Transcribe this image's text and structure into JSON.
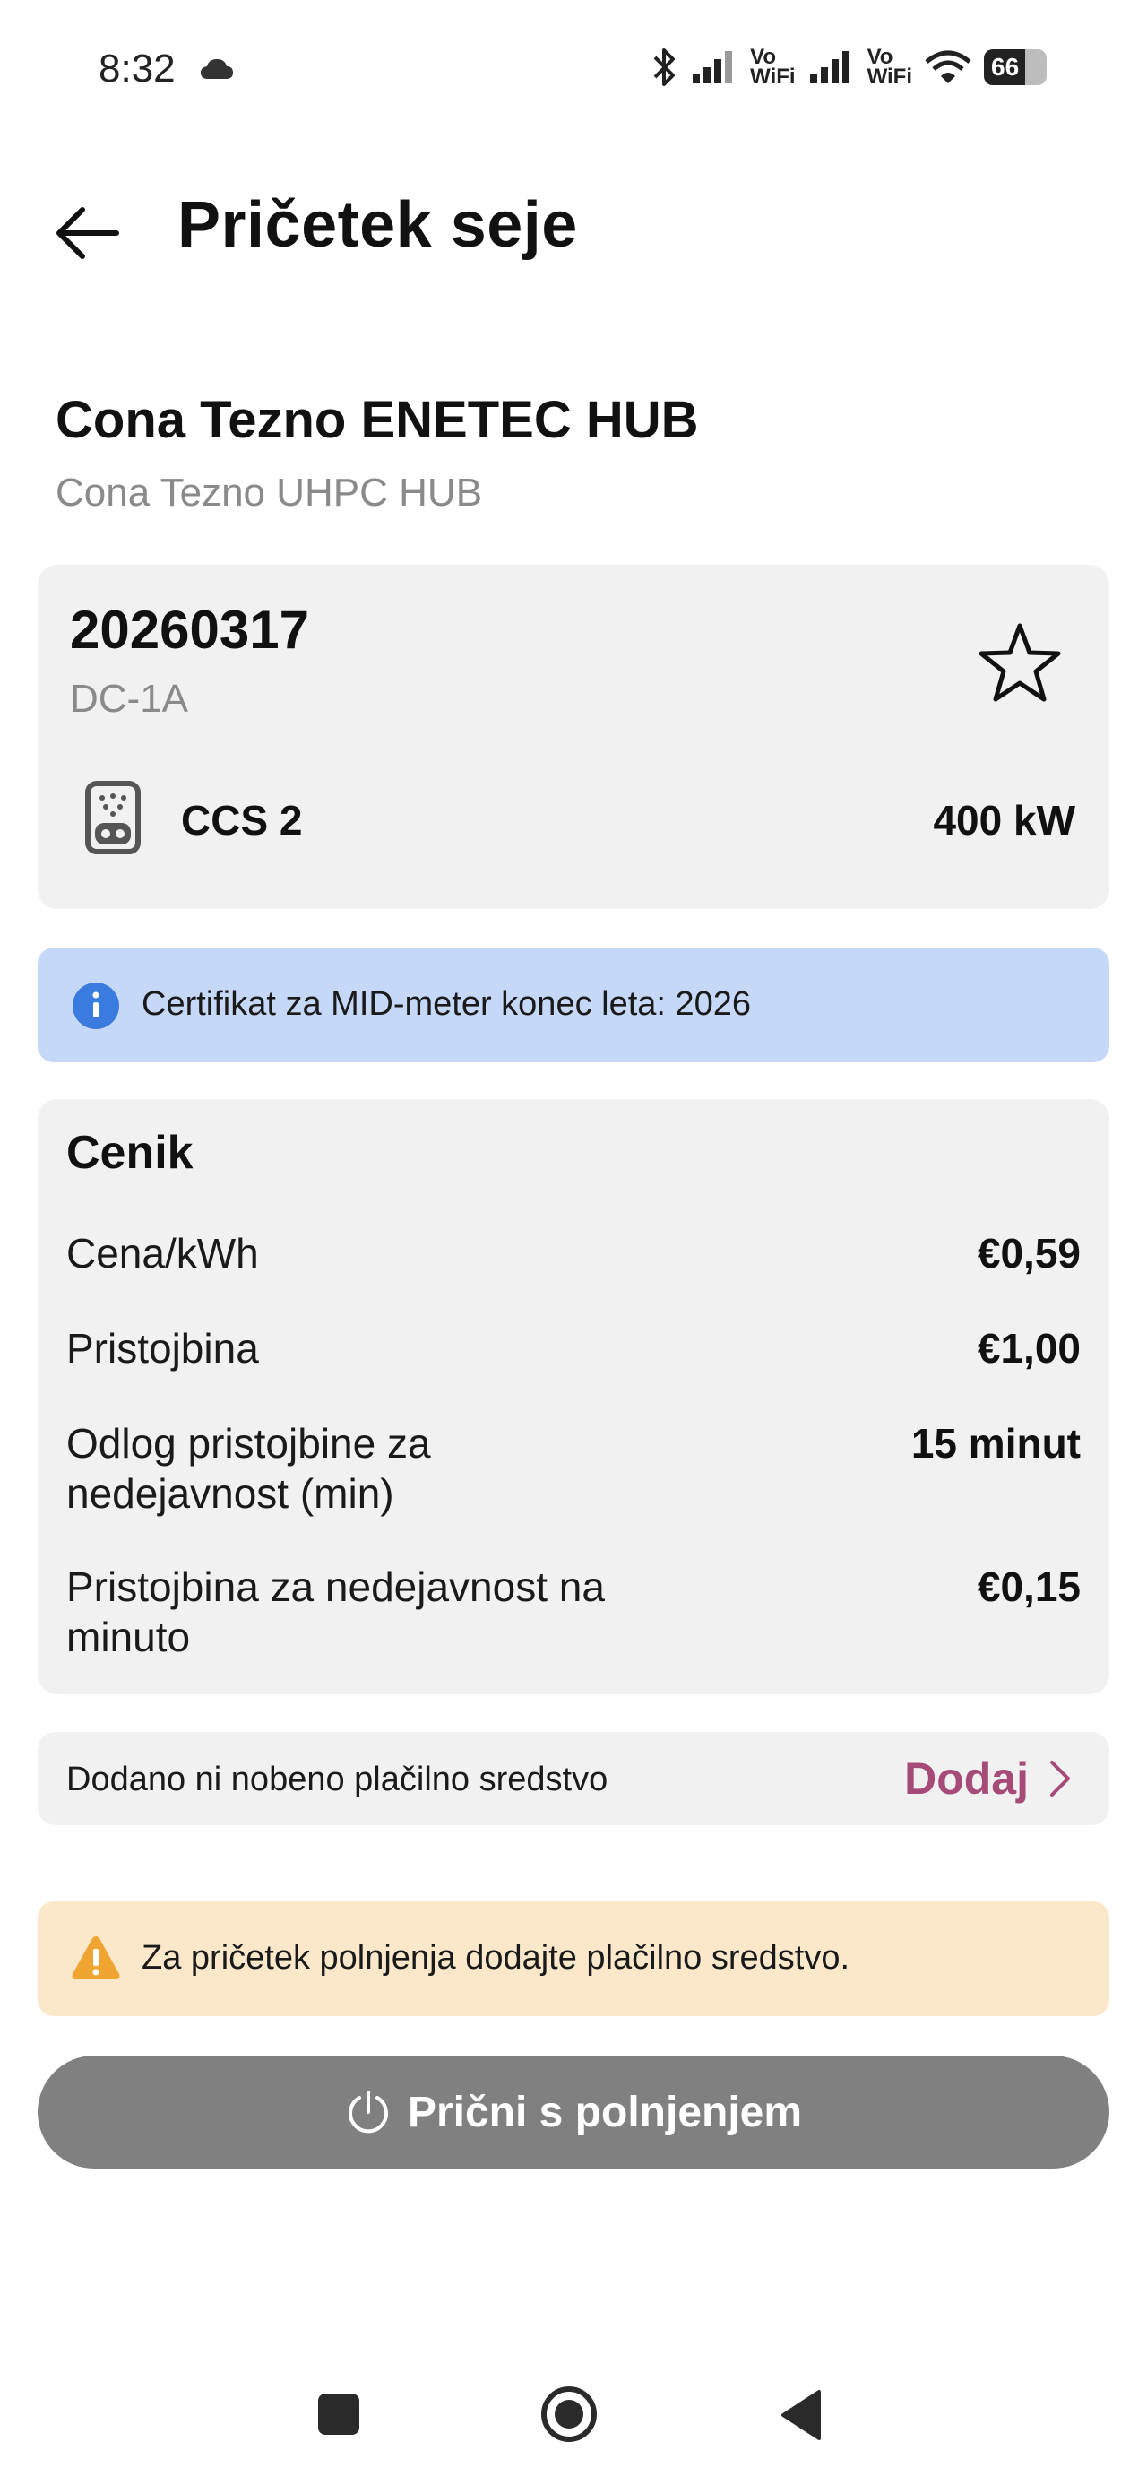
{
  "status_bar": {
    "time": "8:32",
    "vowifi_top": "Vo",
    "vowifi_bottom": "WiFi",
    "battery_level": "66"
  },
  "header": {
    "title": "Pričetek seje"
  },
  "location": {
    "name": "Cona Tezno ENETEC HUB",
    "subtitle": "Cona Tezno UHPC HUB"
  },
  "station": {
    "id": "20260317",
    "code": "DC-1A",
    "connector_type": "CCS 2",
    "power": "400 kW"
  },
  "info_banner": {
    "text": "Certifikat za MID-meter konec leta:  2026",
    "color": "#c6d8f8"
  },
  "pricing": {
    "title": "Cenik",
    "rows": [
      {
        "label": "Cena/kWh",
        "value": "€0,59"
      },
      {
        "label": "Pristojbina",
        "value": "€1,00"
      },
      {
        "label": "Odlog pristojbine za nedejavnost (min)",
        "value": "15 minut"
      },
      {
        "label": "Pristojbina za nedejavnost na minuto",
        "value": "€0,15"
      }
    ]
  },
  "payment": {
    "text": "Dodano ni nobeno plačilno sredstvo",
    "add_label": "Dodaj",
    "accent_color": "#a64b78"
  },
  "warning_banner": {
    "text": "Za pričetek polnjenja dodajte plačilno sredstvo.",
    "color": "#fbe8cb"
  },
  "start_button": {
    "label": "Prični s polnjenjem",
    "state": "disabled"
  },
  "icons": [
    "arrow-left-icon",
    "star-outline-icon",
    "ccs2-connector-icon",
    "info-icon",
    "chevron-right-icon",
    "warning-icon",
    "power-icon"
  ]
}
